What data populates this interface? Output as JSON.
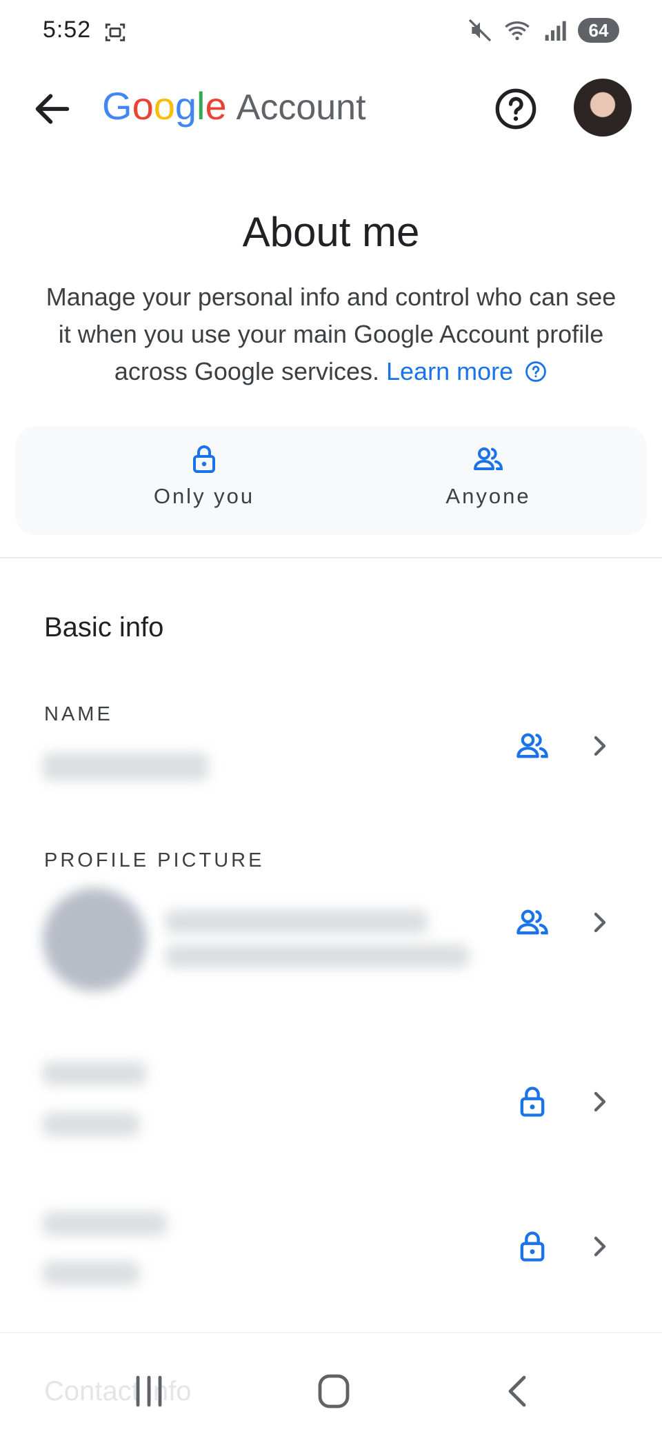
{
  "status_bar": {
    "time": "5:52",
    "battery": "64",
    "icons": [
      "screenshot-icon",
      "mute-icon",
      "wifi-icon",
      "signal-icon"
    ]
  },
  "app_bar": {
    "brand": "Google",
    "product": "Account",
    "icons": [
      "back-arrow-icon",
      "help-circle-icon",
      "avatar"
    ]
  },
  "header": {
    "title": "About me",
    "description": "Manage your personal info and control who can see it when you use your main Google Account profile across Google services.",
    "learn_more": "Learn more"
  },
  "legend": {
    "only_you": "Only you",
    "anyone": "Anyone"
  },
  "basic_info": {
    "title": "Basic info",
    "rows": [
      {
        "label": "NAME",
        "visibility": "anyone"
      },
      {
        "label": "PROFILE PICTURE",
        "visibility": "anyone"
      },
      {
        "label": "",
        "visibility": "only-you"
      },
      {
        "label": "",
        "visibility": "only-you"
      }
    ]
  },
  "next_section": "Contact info",
  "colors": {
    "accent": "#1a73e8",
    "google_blue": "#4285F4",
    "google_red": "#EA4335",
    "google_yellow": "#FBBC05",
    "google_green": "#34A853"
  }
}
